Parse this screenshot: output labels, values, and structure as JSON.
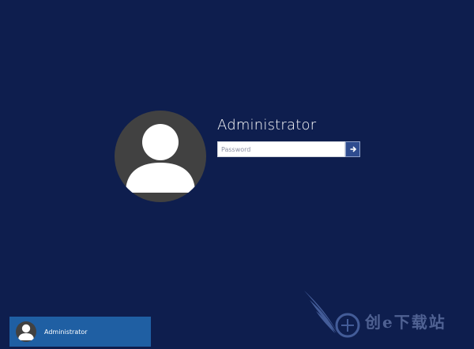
{
  "login": {
    "username": "Administrator",
    "password_placeholder": "Password",
    "submit_icon": "arrow-right-icon"
  },
  "user_tile": {
    "label": "Administrator",
    "avatar_icon": "user-avatar-icon"
  },
  "watermark": {
    "text": "创e下载站",
    "logo_icon": "wing-globe-logo"
  },
  "colors": {
    "background": "#0e1e4e",
    "tile_selected": "#1f5fa3",
    "submit_button": "#2f4c8f",
    "avatar_bg": "#414141"
  }
}
